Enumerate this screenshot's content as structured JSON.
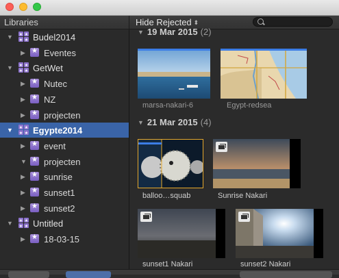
{
  "window": {
    "traffic_lights": [
      "close",
      "minimize",
      "zoom"
    ]
  },
  "header": {
    "libraries_label": "Libraries",
    "filter_label": "Hide Rejected",
    "filter_arrows": "⬍",
    "search_placeholder": ""
  },
  "sidebar": {
    "items": [
      {
        "label": "Budel2014",
        "level": 0,
        "type": "library",
        "expanded": true,
        "selected": false
      },
      {
        "label": "Eventes",
        "level": 1,
        "type": "event",
        "expanded": false,
        "selected": false
      },
      {
        "label": "GetWet",
        "level": 0,
        "type": "library",
        "expanded": true,
        "selected": false
      },
      {
        "label": "Nutec",
        "level": 1,
        "type": "event",
        "expanded": false,
        "selected": false
      },
      {
        "label": "NZ",
        "level": 1,
        "type": "event",
        "expanded": false,
        "selected": false
      },
      {
        "label": "projecten",
        "level": 1,
        "type": "event",
        "expanded": false,
        "selected": false
      },
      {
        "label": "Egypte2014",
        "level": 0,
        "type": "library",
        "expanded": true,
        "selected": true
      },
      {
        "label": "event",
        "level": 1,
        "type": "event",
        "expanded": false,
        "selected": false
      },
      {
        "label": "projecten",
        "level": 1,
        "type": "event",
        "expanded": true,
        "selected": false
      },
      {
        "label": "sunrise",
        "level": 1,
        "type": "event",
        "expanded": false,
        "selected": false
      },
      {
        "label": "sunset1",
        "level": 1,
        "type": "event",
        "expanded": false,
        "selected": false
      },
      {
        "label": "sunset2",
        "level": 1,
        "type": "event",
        "expanded": false,
        "selected": false
      },
      {
        "label": "Untitled",
        "level": 0,
        "type": "library",
        "expanded": true,
        "selected": false
      },
      {
        "label": "18-03-15",
        "level": 1,
        "type": "event",
        "expanded": false,
        "selected": false
      }
    ]
  },
  "browser": {
    "sections": [
      {
        "date": "19 Mar 2015",
        "count": "(2)",
        "clips": [
          {
            "name": "marsa-nakari-6",
            "kind": "still",
            "selected": false
          },
          {
            "name": "Egypt-redsea",
            "kind": "map",
            "selected": false
          }
        ]
      },
      {
        "date": "21 Mar 2015",
        "count": "(4)",
        "clips": [
          {
            "name": "balloo…squab",
            "kind": "fish",
            "selected": true
          },
          {
            "name": "Sunrise Nakari",
            "kind": "compound",
            "selected": false
          },
          {
            "name": "sunset1 Nakari",
            "kind": "compound",
            "selected": false
          },
          {
            "name": "sunset2 Nakari",
            "kind": "compound",
            "selected": false
          }
        ]
      }
    ]
  },
  "colors": {
    "selection": "#3a64a8",
    "clip_marker": "#3c7de6",
    "playhead_selection": "#e8a92b",
    "event_icon": "#8c72cc"
  }
}
